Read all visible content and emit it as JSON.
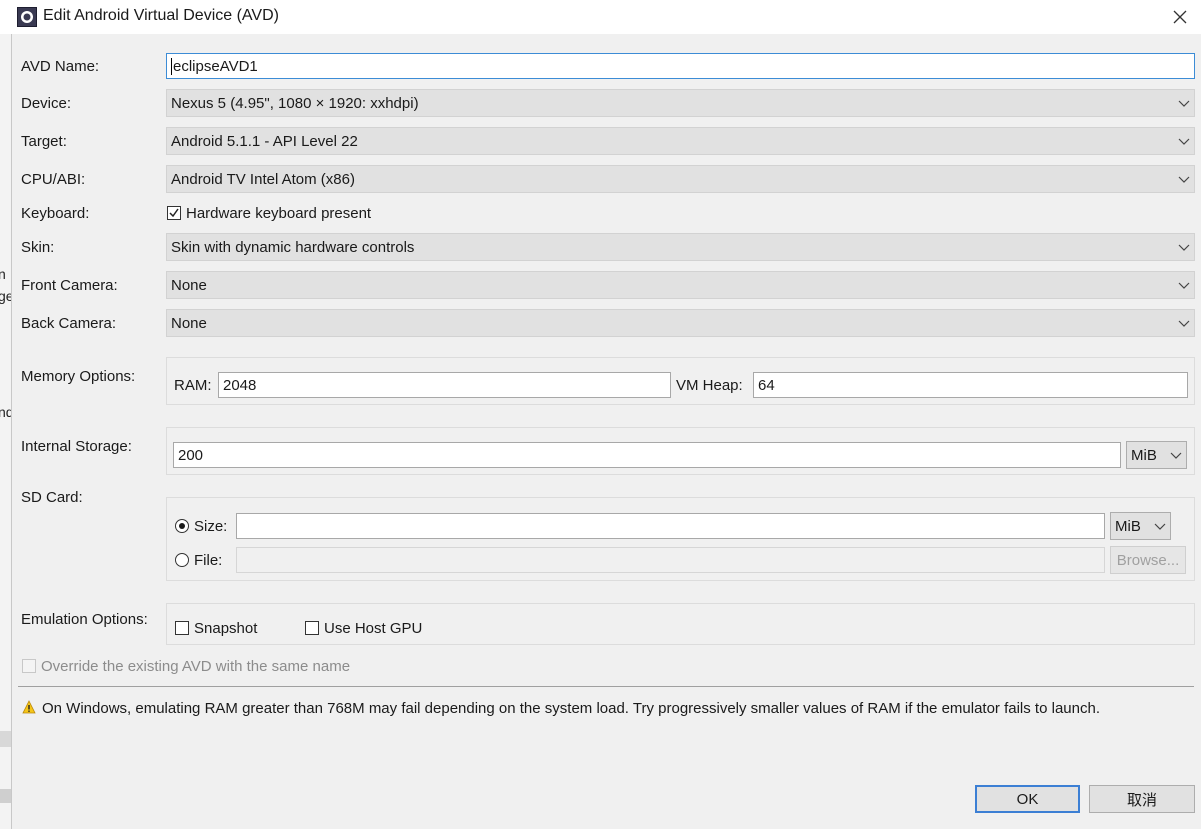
{
  "window": {
    "title": "Edit Android Virtual Device (AVD)"
  },
  "left_strip": {
    "fragments": [
      "n",
      "ge",
      "nd"
    ]
  },
  "form": {
    "avd_name": {
      "label": "AVD Name:",
      "value": "eclipseAVD1"
    },
    "device": {
      "label": "Device:",
      "value": "Nexus 5 (4.95\", 1080 × 1920: xxhdpi)"
    },
    "target": {
      "label": "Target:",
      "value": "Android 5.1.1 - API Level 22"
    },
    "cpu_abi": {
      "label": "CPU/ABI:",
      "value": "Android TV Intel Atom (x86)"
    },
    "keyboard": {
      "label": "Keyboard:",
      "checkbox_label": "Hardware keyboard present",
      "checked": true
    },
    "skin": {
      "label": "Skin:",
      "value": "Skin with dynamic hardware controls"
    },
    "front_camera": {
      "label": "Front Camera:",
      "value": "None"
    },
    "back_camera": {
      "label": "Back Camera:",
      "value": "None"
    },
    "memory": {
      "label": "Memory Options:",
      "ram_label": "RAM:",
      "ram_value": "2048",
      "vm_heap_label": "VM Heap:",
      "vm_heap_value": "64"
    },
    "internal_storage": {
      "label": "Internal Storage:",
      "value": "200",
      "unit": "MiB"
    },
    "sd_card": {
      "label": "SD Card:",
      "size_label": "Size:",
      "size_value": "",
      "size_unit": "MiB",
      "file_label": "File:",
      "file_value": "",
      "browse_label": "Browse...",
      "selected": "size"
    },
    "emulation": {
      "label": "Emulation Options:",
      "snapshot_label": "Snapshot",
      "snapshot_checked": false,
      "host_gpu_label": "Use Host GPU",
      "host_gpu_checked": false
    },
    "override": {
      "label": "Override the existing AVD with the same name",
      "checked": false,
      "enabled": false
    }
  },
  "warning": {
    "icon": "warning-icon",
    "text": "On Windows, emulating RAM greater than 768M may fail depending on the system load. Try progressively smaller values of RAM if the emulator fails to launch."
  },
  "buttons": {
    "ok_label": "OK",
    "cancel_label": "取消"
  },
  "colors": {
    "accent": "#3c7fd4",
    "dialog_bg": "#f0f0f0",
    "combo_bg": "#e1e1e1"
  }
}
